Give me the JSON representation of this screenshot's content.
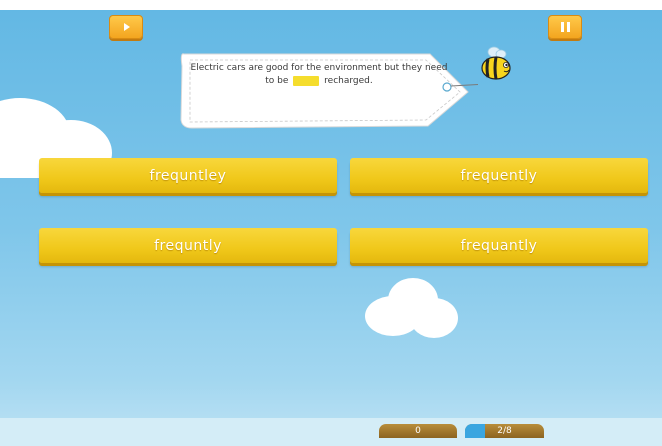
{
  "question": {
    "before_blank": "Electric cars are good for the environment but they need to be",
    "after_blank": "recharged."
  },
  "answers": [
    {
      "label": "frequntley"
    },
    {
      "label": "frequently"
    },
    {
      "label": "frequntly"
    },
    {
      "label": "frequantly"
    }
  ],
  "score": "0",
  "progress": {
    "text": "2/8",
    "fraction": 0.25
  },
  "icons": {
    "play": "play-icon",
    "pause": "pause-icon",
    "mascot": "bee-icon"
  },
  "colors": {
    "sky": "#63b8e4",
    "answer": "#f0c81a",
    "blank": "#f5dd2d",
    "button": "#f3a51f"
  }
}
